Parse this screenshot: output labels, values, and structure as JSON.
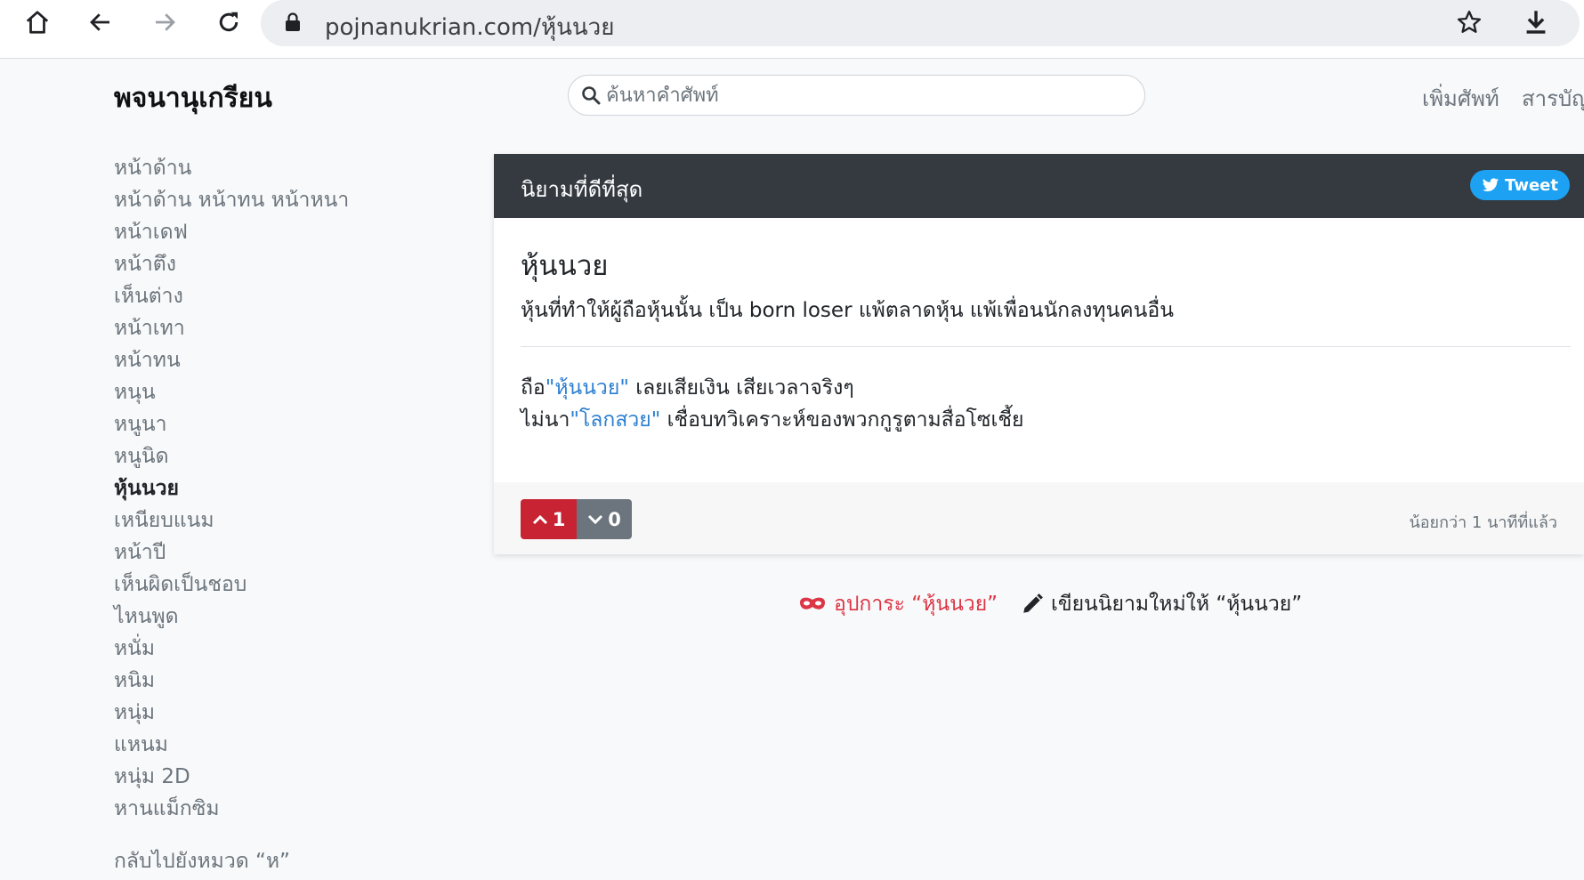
{
  "browser": {
    "url": "pojnanukrian.com/หุ้นนวย",
    "icons": [
      "home-icon",
      "back-arrow-icon",
      "forward-arrow-icon",
      "reload-icon",
      "lock-icon",
      "star-icon",
      "download-icon"
    ]
  },
  "header": {
    "brand": "พจนานุเกรียน",
    "search_placeholder": "ค้นหาคำศัพท์",
    "nav": [
      "เพิ่มศัพท์",
      "สารบัญ"
    ]
  },
  "sidebar": {
    "items": [
      {
        "label": "หน้าด้าน",
        "active": false
      },
      {
        "label": "หน้าด้าน หน้าทน หน้าหนา",
        "active": false
      },
      {
        "label": "หน้าเดฟ",
        "active": false
      },
      {
        "label": "หน้าตึง",
        "active": false
      },
      {
        "label": "เห็นต่าง",
        "active": false
      },
      {
        "label": "หน้าเทา",
        "active": false
      },
      {
        "label": "หน้าทน",
        "active": false
      },
      {
        "label": "หนุน",
        "active": false
      },
      {
        "label": "หนูนา",
        "active": false
      },
      {
        "label": "หนูนิด",
        "active": false
      },
      {
        "label": "หุ้นนวย",
        "active": true
      },
      {
        "label": "เหนียบแนม",
        "active": false
      },
      {
        "label": "หน้าปี",
        "active": false
      },
      {
        "label": "เห็นผิดเป็นชอบ",
        "active": false
      },
      {
        "label": "ไหนพูด",
        "active": false
      },
      {
        "label": "หนั่ม",
        "active": false
      },
      {
        "label": "หนิม",
        "active": false
      },
      {
        "label": "หนุ่ม",
        "active": false
      },
      {
        "label": "แหนม",
        "active": false
      },
      {
        "label": "หนุ่ม 2D",
        "active": false
      },
      {
        "label": "หานแม็กซิม",
        "active": false
      }
    ],
    "back_link": "กลับไปยังหมวด “ห”"
  },
  "card": {
    "header_title": "นิยามที่ดีที่สุด",
    "tweet_label": "Tweet",
    "word": "หุ้นนวย",
    "meaning": "หุ้นที่ทำให้ผู้ถือหุ้นนั้น เป็น born loser แพ้ตลาดหุ้น แพ้เพื่อนนักลงทุนคนอื่น",
    "examples": [
      {
        "pre": "ถือ",
        "link": "\"หุ้นนวย\"",
        "post": " เลยเสียเงิน เสียเวลาจริงๆ"
      },
      {
        "pre": "ไม่นา",
        "link": "\"โลกสวย\"",
        "post": " เชื่อบทวิเคราะห์ของพวกกูรูตามสื่อโซเชี้ย"
      }
    ],
    "upvotes": "1",
    "downvotes": "0",
    "timestamp": "น้อยกว่า 1 นาทีที่แล้ว"
  },
  "actions": {
    "euphemism": "อุปการะ “หุ้นนวย”",
    "write_new": "เขียนนิยามใหม่ให้ “หุ้นนวย”"
  },
  "colors": {
    "header_dark": "#343a40",
    "upvote_red": "#c82333",
    "downvote_gray": "#6c757d",
    "tweet_blue": "#1da1f2",
    "link_blue": "#2c7fd0"
  }
}
